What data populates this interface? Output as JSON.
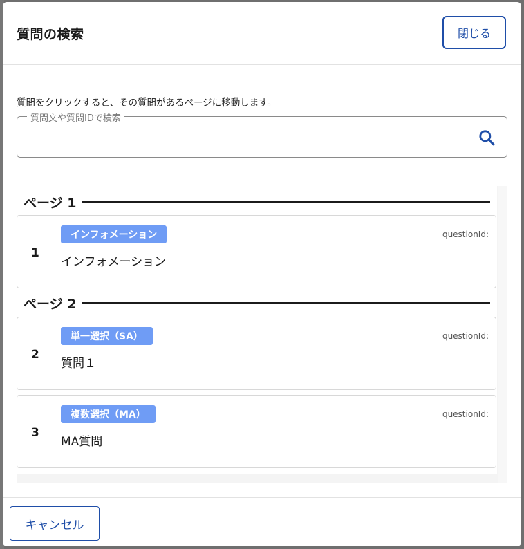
{
  "dialog": {
    "title": "質問の検索",
    "close_label": "閉じる",
    "instruction": "質問をクリックすると、その質問があるページに移動します。",
    "search": {
      "legend": "質問文や質問IDで検索",
      "value": ""
    },
    "pages": [
      {
        "heading": "ページ 1",
        "questions": [
          {
            "number": "1",
            "badge": "インフォメーション",
            "text": "インフォメーション",
            "qid_label": "questionId:"
          }
        ]
      },
      {
        "heading": "ページ 2",
        "questions": [
          {
            "number": "2",
            "badge": "単一選択（SA）",
            "text": "質問１",
            "qid_label": "questionId:"
          },
          {
            "number": "3",
            "badge": "複数選択（MA）",
            "text": "MA質問",
            "qid_label": "questionId:"
          }
        ]
      }
    ],
    "cancel_label": "キャンセル"
  },
  "colors": {
    "accent": "#1f4ea8",
    "badge": "#6f9cf5"
  },
  "icons": {
    "search": "search-icon"
  }
}
